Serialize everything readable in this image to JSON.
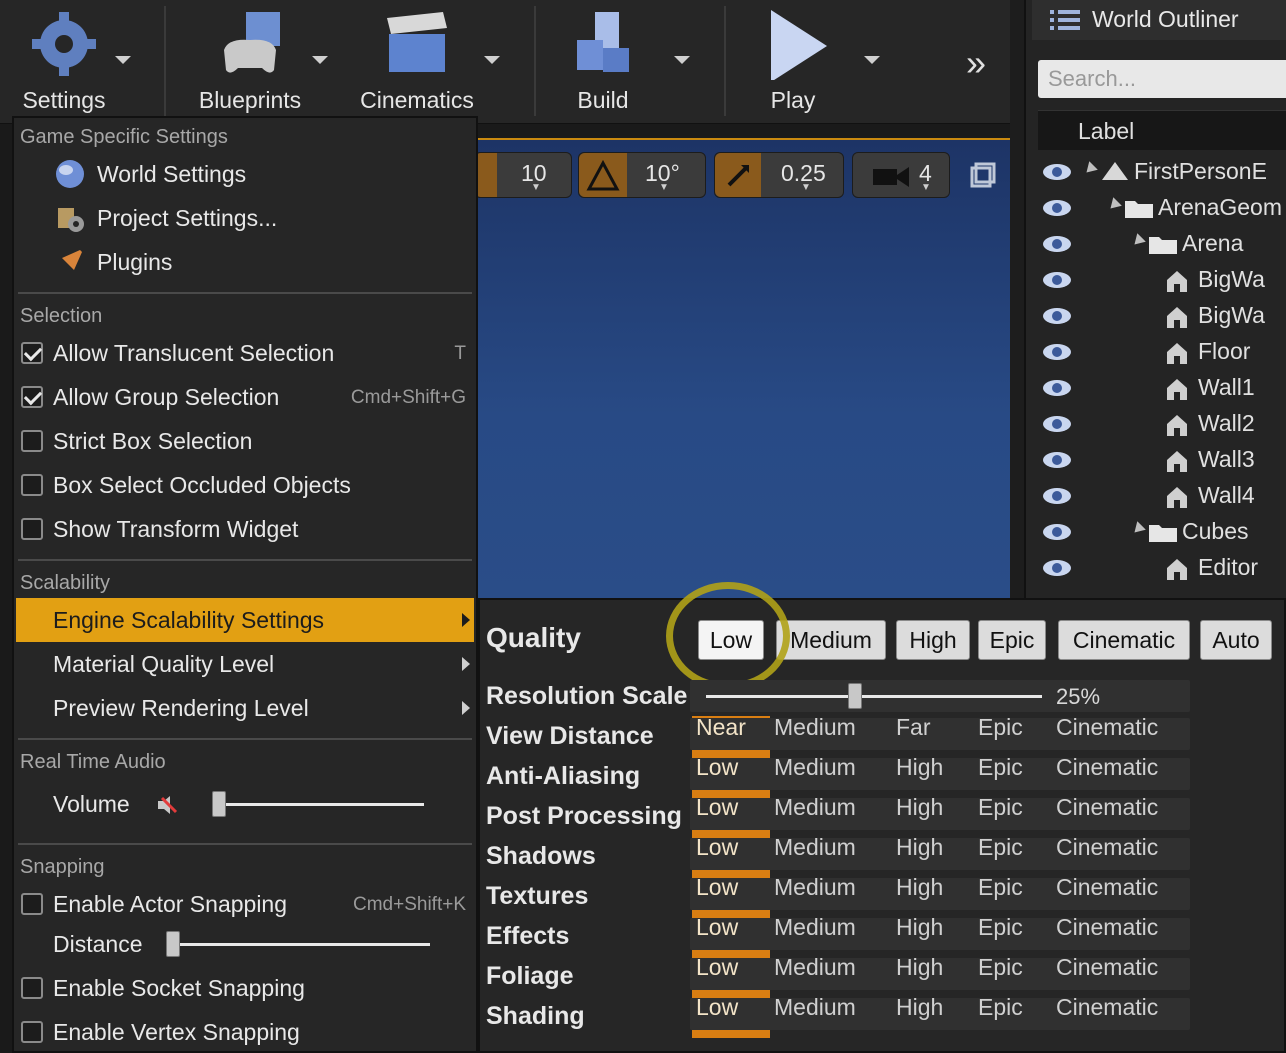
{
  "toolbar": {
    "settings": "Settings",
    "blueprints": "Blueprints",
    "cinematics": "Cinematics",
    "build": "Build",
    "play": "Play",
    "more": "»"
  },
  "viewport": {
    "grid_snap": "10",
    "rotation_snap": "10°",
    "scale_snap": "0.25",
    "camera_speed": "4"
  },
  "outliner": {
    "title": "World Outliner",
    "search_placeholder": "Search...",
    "column_label": "Label",
    "rows": [
      {
        "label": "FirstPersonE"
      },
      {
        "label": "ArenaGeom"
      },
      {
        "label": "Arena"
      },
      {
        "label": "BigWa"
      },
      {
        "label": "BigWa"
      },
      {
        "label": "Floor"
      },
      {
        "label": "Wall1"
      },
      {
        "label": "Wall2"
      },
      {
        "label": "Wall3"
      },
      {
        "label": "Wall4"
      },
      {
        "label": "Cubes"
      },
      {
        "label": "Editor"
      }
    ]
  },
  "menu": {
    "sections": {
      "game_specific": "Game Specific Settings",
      "selection": "Selection",
      "scalability": "Scalability",
      "audio": "Real Time Audio",
      "snapping": "Snapping"
    },
    "world_settings": "World Settings",
    "project_settings": "Project Settings...",
    "plugins": "Plugins",
    "allow_translucent": "Allow Translucent Selection",
    "allow_translucent_sc": "T",
    "allow_group": "Allow Group Selection",
    "allow_group_sc": "Cmd+Shift+G",
    "strict_box": "Strict Box Selection",
    "box_occluded": "Box Select Occluded Objects",
    "show_transform": "Show Transform Widget",
    "engine_scalability": "Engine Scalability Settings",
    "material_quality": "Material Quality Level",
    "preview_rendering": "Preview Rendering Level",
    "volume": "Volume",
    "enable_actor_snapping": "Enable Actor Snapping",
    "enable_actor_snapping_sc": "Cmd+Shift+K",
    "distance": "Distance",
    "enable_socket_snapping": "Enable Socket Snapping",
    "enable_vertex_snapping": "Enable Vertex Snapping"
  },
  "scalability": {
    "title": "Quality",
    "presets": [
      "Low",
      "Medium",
      "High",
      "Epic",
      "Cinematic",
      "Auto"
    ],
    "selected_preset": "Low",
    "resolution_scale_label": "Resolution Scale",
    "resolution_scale_value": "25%",
    "rows": [
      {
        "label": "View Distance",
        "options": [
          "Near",
          "Medium",
          "Far",
          "Epic",
          "Cinematic"
        ],
        "selected": 0
      },
      {
        "label": "Anti-Aliasing",
        "options": [
          "Low",
          "Medium",
          "High",
          "Epic",
          "Cinematic"
        ],
        "selected": 0
      },
      {
        "label": "Post Processing",
        "options": [
          "Low",
          "Medium",
          "High",
          "Epic",
          "Cinematic"
        ],
        "selected": 0
      },
      {
        "label": "Shadows",
        "options": [
          "Low",
          "Medium",
          "High",
          "Epic",
          "Cinematic"
        ],
        "selected": 0
      },
      {
        "label": "Textures",
        "options": [
          "Low",
          "Medium",
          "High",
          "Epic",
          "Cinematic"
        ],
        "selected": 0
      },
      {
        "label": "Effects",
        "options": [
          "Low",
          "Medium",
          "High",
          "Epic",
          "Cinematic"
        ],
        "selected": 0
      },
      {
        "label": "Foliage",
        "options": [
          "Low",
          "Medium",
          "High",
          "Epic",
          "Cinematic"
        ],
        "selected": 0
      },
      {
        "label": "Shading",
        "options": [
          "Low",
          "Medium",
          "High",
          "Epic",
          "Cinematic"
        ],
        "selected": 0
      }
    ]
  },
  "colors": {
    "highlight": "#e2a013",
    "selected_column": "#d97e12",
    "annotation_circle": "#b0a218"
  }
}
